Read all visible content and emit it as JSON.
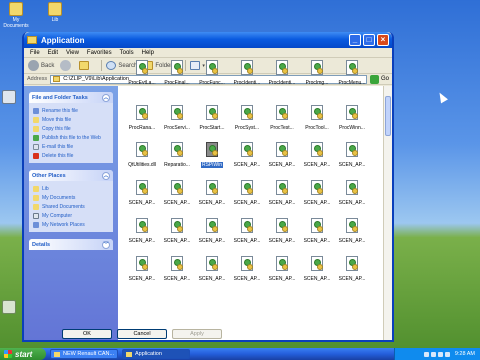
{
  "desktop": {
    "icons": [
      {
        "label": "My Documents",
        "type": "folder"
      },
      {
        "label": "Lib",
        "type": "folder"
      },
      {
        "label": "My Computer",
        "type": "pc"
      },
      {
        "label": "Recycle Bin",
        "type": "bin"
      }
    ]
  },
  "window": {
    "title": "Application",
    "buttons": {
      "minimize": "_",
      "maximize": "□",
      "close": "×"
    }
  },
  "menu": [
    "File",
    "Edit",
    "View",
    "Favorites",
    "Tools",
    "Help"
  ],
  "toolbar": {
    "back": "Back",
    "search": "Search",
    "folders": "Folders"
  },
  "address": {
    "label": "Address",
    "value": "C:\\ZLIP_V9\\Lib\\Application",
    "go": "Go"
  },
  "tasks_panel": {
    "file_folder": {
      "title": "File and Folder Tasks",
      "items": [
        "Rename this file",
        "Move this file",
        "Copy this file",
        "Publish this file to the Web",
        "E-mail this file",
        "Delete this file"
      ]
    },
    "other_places": {
      "title": "Other Places",
      "items": [
        "Lib",
        "My Documents",
        "Shared Documents",
        "My Computer",
        "My Network Places"
      ]
    },
    "details": {
      "title": "Details"
    }
  },
  "files": [
    "ProcEvtLa...",
    "ProcFinal...",
    "ProcFunc...",
    "ProcIdenti...",
    "ProcIdenti...",
    "ProcImg...",
    "ProcMenu...",
    "ProcRana...",
    "ProcServi...",
    "ProcStart...",
    "ProcSyst...",
    "ProcTest...",
    "ProcTool...",
    "ProcWinn...",
    "QtUtilities.dll",
    "Reparatio...",
    "RSPiWin",
    "SCEN_AP...",
    "SCEN_AP...",
    "SCEN_AP...",
    "SCEN_AP...",
    "SCEN_AP...",
    "SCEN_AP...",
    "SCEN_AP...",
    "SCEN_AP...",
    "SCEN_AP...",
    "SCEN_AP...",
    "SCEN_AP...",
    "SCEN_AP...",
    "SCEN_AP...",
    "SCEN_AP...",
    "SCEN_AP...",
    "SCEN_AP...",
    "SCEN_AP...",
    "SCEN_AP...",
    "SCEN_AP...",
    "SCEN_AP...",
    "SCEN_AP...",
    "SCEN_AP...",
    "SCEN_AP...",
    "SCEN_AP...",
    "SCEN_AP..."
  ],
  "selected_file_index": 16,
  "dialog_buttons": {
    "ok": "OK",
    "cancel": "Cancel",
    "apply": "Apply"
  },
  "taskbar": {
    "start": "start",
    "items": [
      "NEW Renault CAN...",
      "Application"
    ],
    "clock": "9:28 AM"
  }
}
